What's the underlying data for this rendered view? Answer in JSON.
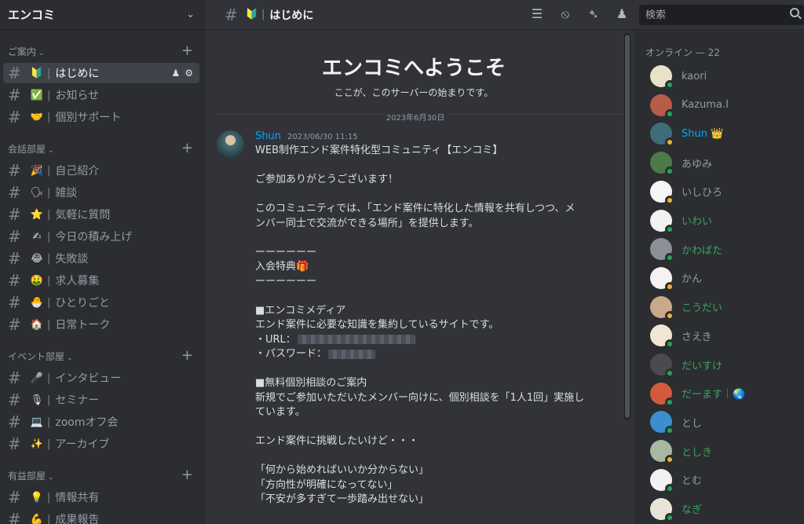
{
  "server": {
    "name": "エンコミ"
  },
  "sidebar": {
    "categories": [
      {
        "label": "ご案内",
        "channels": [
          {
            "emoji": "🔰",
            "label": "はじめに"
          },
          {
            "emoji": "✅",
            "label": "お知らせ"
          },
          {
            "emoji": "🤝",
            "label": "個別サポート"
          }
        ]
      },
      {
        "label": "会話部屋",
        "channels": [
          {
            "emoji": "🎉",
            "label": "自己紹介"
          },
          {
            "emoji": "🗣",
            "label": "雑談"
          },
          {
            "emoji": "⭐",
            "label": "気軽に質問"
          },
          {
            "emoji": "✍",
            "label": "今日の積み上げ"
          },
          {
            "emoji": "😂",
            "label": "失敗談"
          },
          {
            "emoji": "🤑",
            "label": "求人募集"
          },
          {
            "emoji": "🐣",
            "label": "ひとりごと"
          },
          {
            "emoji": "🏠",
            "label": "日常トーク"
          }
        ]
      },
      {
        "label": "イベント部屋",
        "channels": [
          {
            "emoji": "🎤",
            "label": "インタビュー"
          },
          {
            "emoji": "🎙",
            "label": "セミナー"
          },
          {
            "emoji": "💻",
            "label": "zoomオフ会"
          },
          {
            "emoji": "✨",
            "label": "アーカイブ"
          }
        ]
      },
      {
        "label": "有益部屋",
        "channels": [
          {
            "emoji": "💡",
            "label": "情報共有"
          },
          {
            "emoji": "💪",
            "label": "成果報告"
          }
        ]
      }
    ]
  },
  "topbar": {
    "channel_emoji": "🔰",
    "channel_name": "はじめに",
    "icons": [
      "threads-icon",
      "mute-bell-icon",
      "pin-icon",
      "members-icon"
    ],
    "search_placeholder": "検索"
  },
  "chat": {
    "welcome_title": "エンコミへようこそ",
    "welcome_sub": "ここが、このサーバーの始まりです。",
    "date_divider": "2023年6月30日",
    "message": {
      "author": "Shun",
      "timestamp": "2023/06/30 11:15",
      "lines": [
        "WEB制作エンド案件特化型コミュニティ【エンコミ】",
        "",
        "ご参加ありがとうございます！",
        "",
        "このコミュニティでは、「エンド案件に特化した情報を共有しつつ、メ",
        "ンバー同士で交流ができる場所」を提供します。",
        "",
        "ーーーーーー",
        "入会特典🎁",
        "ーーーーーー",
        "",
        "■エンコミメディア",
        "エンド案件に必要な知識を集約しているサイトです。",
        "・URL：",
        "・パスワード：",
        "",
        "■無料個別相談のご案内",
        "新規でご参加いただいたメンバー向けに、個別相談を「1人1回」実施し",
        "ています。",
        "",
        "エンド案件に挑戦したいけど・・・",
        "",
        "「何から始めればいいか分からない」",
        "「方向性が明確になってない」",
        "「不安が多すぎて一歩踏み出せない」"
      ]
    }
  },
  "members": {
    "header": "オンライン — 22",
    "list": [
      {
        "name": "kaori",
        "color": "#949ba4",
        "avatar": "#e8e3c8",
        "status": "#23a55a"
      },
      {
        "name": "Kazuma.I",
        "color": "#949ba4",
        "avatar": "#b85c4a",
        "status": "#23a55a"
      },
      {
        "name": "Shun",
        "badge": "👑",
        "color": "#00a8fc",
        "avatar": "#3e6d78",
        "status": "#f0b232"
      },
      {
        "name": "あゆみ",
        "color": "#949ba4",
        "avatar": "#4c7a4a",
        "status": "#23a55a"
      },
      {
        "name": "いしひろ",
        "color": "#949ba4",
        "avatar": "#f5f5f5",
        "status": "#f0b232"
      },
      {
        "name": "いわい",
        "color": "#3ba55c",
        "avatar": "#f2f2f2",
        "status": "#23a55a"
      },
      {
        "name": "かわばた",
        "color": "#3ba55c",
        "avatar": "#8a8f98",
        "status": "#23a55a"
      },
      {
        "name": "かん",
        "color": "#949ba4",
        "avatar": "#f7f2f2",
        "status": "#f0b232"
      },
      {
        "name": "こうだい",
        "color": "#3ba55c",
        "avatar": "#c9a98a",
        "status": "#f0b232"
      },
      {
        "name": "さえき",
        "color": "#949ba4",
        "avatar": "#f1e6d4",
        "status": "#23a55a"
      },
      {
        "name": "だいすけ",
        "color": "#3ba55c",
        "avatar": "#4b4a50",
        "status": "#23a55a"
      },
      {
        "name": "だーます｜🌏",
        "color": "#3ba55c",
        "avatar": "#d45a3c",
        "status": "#23a55a"
      },
      {
        "name": "とし",
        "color": "#949ba4",
        "avatar": "#3b8fd0",
        "status": "#23a55a"
      },
      {
        "name": "としき",
        "color": "#3ba55c",
        "avatar": "#a7b9a0",
        "status": "#f0b232"
      },
      {
        "name": "とむ",
        "color": "#949ba4",
        "avatar": "#f2f2f2",
        "status": "#23a55a"
      },
      {
        "name": "なぎ",
        "color": "#3ba55c",
        "avatar": "#e9e4d8",
        "status": "#23a55a"
      }
    ]
  }
}
